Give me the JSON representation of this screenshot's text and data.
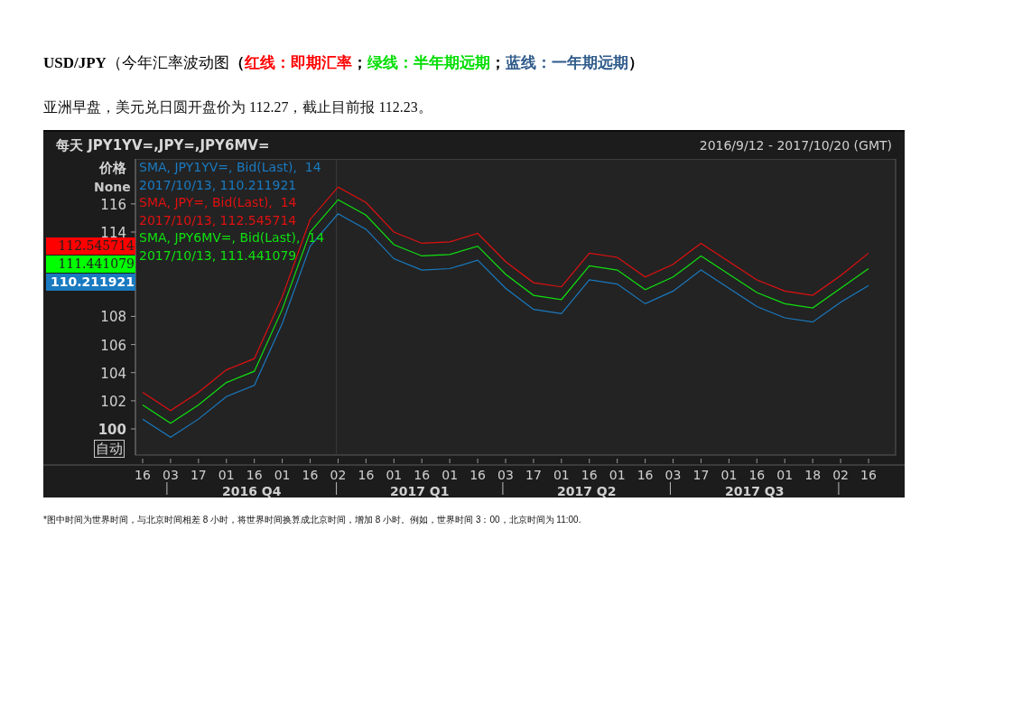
{
  "heading": {
    "parts": [
      {
        "text": "USD/JPY",
        "color": "#000000",
        "bold": true
      },
      {
        "text": "（今年汇率波动图",
        "color": "#000000",
        "bold": false
      },
      {
        "text": "（",
        "color": "#000000",
        "bold": true
      },
      {
        "text": "红线：即期汇率",
        "color": "#ff0000",
        "bold": true
      },
      {
        "text": "；",
        "color": "#000000",
        "bold": true
      },
      {
        "text": "绿线：半年期远期",
        "color": "#00dd00",
        "bold": true
      },
      {
        "text": "；",
        "color": "#000000",
        "bold": true
      },
      {
        "text": "蓝线：一年期远期",
        "color": "#2e5a8a",
        "bold": true
      },
      {
        "text": "）",
        "color": "#000000",
        "bold": true
      }
    ]
  },
  "paragraph": "亚洲早盘，美元兑日圆开盘价为 112.27，截止目前报 112.23。",
  "chart": {
    "range": "2016/9/12 - 2017/10/20 (GMT)",
    "axis_title": "价格",
    "axis_subtitle": "None",
    "auto_button": "自动",
    "legend_dates": [
      "2017/10/13, 110.211921",
      "2017/10/13, 112.545714",
      "2017/10/13, 111.441079"
    ],
    "badges": [
      {
        "text": "112.545714",
        "color": "#ff0000",
        "bold": false
      },
      {
        "text": "111.441079",
        "color": "#00ff00",
        "bold": false
      },
      {
        "text": "110.211921",
        "color": "#1a7ac0",
        "bold": true
      }
    ],
    "quarters": [
      "2016 Q4",
      "2017 Q1",
      "2017 Q2",
      "2017 Q3"
    ],
    "chart_data": {
      "type": "line",
      "title": "每天 JPY1YV=,JPY=,JPY6MV=",
      "categories": [
        "16",
        "03",
        "17",
        "01",
        "16",
        "01",
        "16",
        "02",
        "16",
        "01",
        "16",
        "01",
        "16",
        "03",
        "17",
        "01",
        "16",
        "01",
        "16",
        "03",
        "17",
        "01",
        "16",
        "01",
        "18",
        "02",
        "16"
      ],
      "series": [
        {
          "name": "SMA, JPY1YV=, Bid(Last),  14",
          "color": "#1a7ac0",
          "values": [
            100.7,
            99.4,
            100.7,
            102.3,
            103.1,
            107.5,
            113.0,
            115.3,
            114.2,
            112.1,
            111.3,
            111.4,
            112.0,
            110.0,
            108.5,
            108.2,
            110.6,
            110.3,
            108.9,
            109.8,
            111.3,
            110.0,
            108.7,
            107.9,
            107.6,
            109.0,
            110.2
          ]
        },
        {
          "name": "SMA, JPY=, Bid(Last),  14",
          "color": "#e01010",
          "values": [
            102.6,
            101.3,
            102.6,
            104.2,
            105.0,
            109.4,
            114.9,
            117.2,
            116.1,
            114.0,
            113.2,
            113.3,
            113.9,
            111.9,
            110.4,
            110.1,
            112.5,
            112.2,
            110.8,
            111.7,
            113.2,
            111.9,
            110.6,
            109.8,
            109.5,
            110.9,
            112.5
          ]
        },
        {
          "name": "SMA, JPY6MV=, Bid(Last),  14",
          "color": "#10e010",
          "values": [
            101.7,
            100.4,
            101.7,
            103.3,
            104.1,
            108.5,
            114.0,
            116.3,
            115.2,
            113.1,
            112.3,
            112.4,
            113.0,
            111.0,
            109.5,
            109.2,
            111.6,
            111.3,
            109.9,
            110.8,
            112.3,
            111.0,
            109.7,
            108.9,
            108.6,
            110.0,
            111.4
          ]
        }
      ],
      "ylim": [
        98.14,
        119.2
      ],
      "yticks": [
        {
          "value": 100,
          "label": "100"
        },
        102,
        104,
        106,
        108,
        114,
        116
      ]
    }
  },
  "footnote": "*图中时间为世界时间，与北京时间相差 8 小时，将世界时间换算成北京时间，增加 8 小时。例如，世界时间 3：00，北京时间为 11:00."
}
